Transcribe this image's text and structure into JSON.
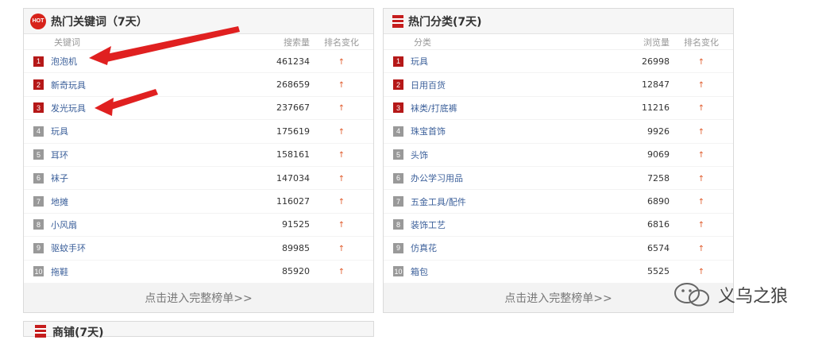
{
  "keywords": {
    "title": "热门关键词（7天）",
    "hot_label": "HOT",
    "col_keyword": "关键词",
    "col_search": "搜索量",
    "col_change": "排名变化",
    "rows": [
      {
        "rank": "1",
        "name": "泡泡机",
        "value": "461234"
      },
      {
        "rank": "2",
        "name": "新奇玩具",
        "value": "268659"
      },
      {
        "rank": "3",
        "name": "发光玩具",
        "value": "237667"
      },
      {
        "rank": "4",
        "name": "玩具",
        "value": "175619"
      },
      {
        "rank": "5",
        "name": "耳环",
        "value": "158161"
      },
      {
        "rank": "6",
        "name": "袜子",
        "value": "147034"
      },
      {
        "rank": "7",
        "name": "地摊",
        "value": "116027"
      },
      {
        "rank": "8",
        "name": "小风扇",
        "value": "91525"
      },
      {
        "rank": "9",
        "name": "驱蚊手环",
        "value": "89985"
      },
      {
        "rank": "10",
        "name": "拖鞋",
        "value": "85920"
      }
    ],
    "more": "点击进入完整榜单>>"
  },
  "categories": {
    "title": "热门分类(7天)",
    "col_category": "分类",
    "col_views": "浏览量",
    "col_change": "排名变化",
    "rows": [
      {
        "rank": "1",
        "name": "玩具",
        "value": "26998"
      },
      {
        "rank": "2",
        "name": "日用百货",
        "value": "12847"
      },
      {
        "rank": "3",
        "name": "袜类/打底裤",
        "value": "11216"
      },
      {
        "rank": "4",
        "name": "珠宝首饰",
        "value": "9926"
      },
      {
        "rank": "5",
        "name": "头饰",
        "value": "9069"
      },
      {
        "rank": "6",
        "name": "办公学习用品",
        "value": "7258"
      },
      {
        "rank": "7",
        "name": "五金工具/配件",
        "value": "6890"
      },
      {
        "rank": "8",
        "name": "装饰工艺",
        "value": "6816"
      },
      {
        "rank": "9",
        "name": "仿真花",
        "value": "6574"
      },
      {
        "rank": "10",
        "name": "箱包",
        "value": "5525"
      }
    ],
    "more": "点击进入完整榜单>>"
  },
  "bottom_panel": {
    "title": "商铺(7天)"
  },
  "watermark": {
    "text": "义乌之狼"
  },
  "change_arrow": "↑",
  "colors": {
    "accent_red": "#d7221a",
    "rank_top": "#b51818",
    "rank_low": "#999999",
    "arrow": "#e05a2b",
    "callout": "#e02020"
  }
}
